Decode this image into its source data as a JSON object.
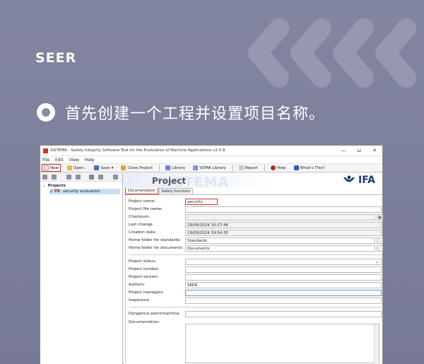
{
  "brand": {
    "logo": "SEER"
  },
  "headline": "首先创建一个工程并设置项目名称。",
  "window": {
    "title": "SISTEMA - Safety Integrity Software Tool for the Evaluation of Machine Applications v2.0.8",
    "controls": {
      "minimize": "—",
      "maximize": "⊔",
      "close": "✕"
    },
    "menu": [
      "File",
      "Edit",
      "View",
      "Help"
    ],
    "toolbar": {
      "new": "New",
      "open": "Open..",
      "save": "Save",
      "close_project": "Close Project",
      "library": "Library",
      "vdma_library": "VDMA Library",
      "report": "Report",
      "help": "Help",
      "whats_this": "What's This?"
    },
    "tree": {
      "root": "Projects",
      "item_code": "PR",
      "item": "security evaluation"
    },
    "header": {
      "watermark": "SISTEMA",
      "title": "Project",
      "ifa": "IFA"
    },
    "tabs": [
      "Documentation",
      "Safety functions"
    ],
    "form": {
      "project_name_label": "Project name:",
      "project_name": "security evaluation",
      "project_file_label": "Project file name:",
      "project_file": "",
      "checksum_label": "Checksum:",
      "checksum": "-",
      "last_change_label": "Last change:",
      "last_change": "29/09/2024 16:27:46",
      "creation_label": "Creation date:",
      "creation": "19/09/2024 19:54:35",
      "home_standards_label": "Home folder for standards:",
      "home_standards": "Standards",
      "home_documents_label": "Home folder for documents:",
      "home_documents": "Documents",
      "status_label": "Project status:",
      "status": "",
      "number_label": "Project number:",
      "version_label": "Project version:",
      "authors_label": "Authors:",
      "authors": "SEER",
      "managers_label": "Project managers:",
      "inspectors_label": "Inspectors:",
      "danger_label": "Dangerous point/machine:",
      "documentation_label": "Documentation:"
    }
  },
  "colors": {
    "highlight": "#d52b2b",
    "selection": "#c7dff6"
  }
}
